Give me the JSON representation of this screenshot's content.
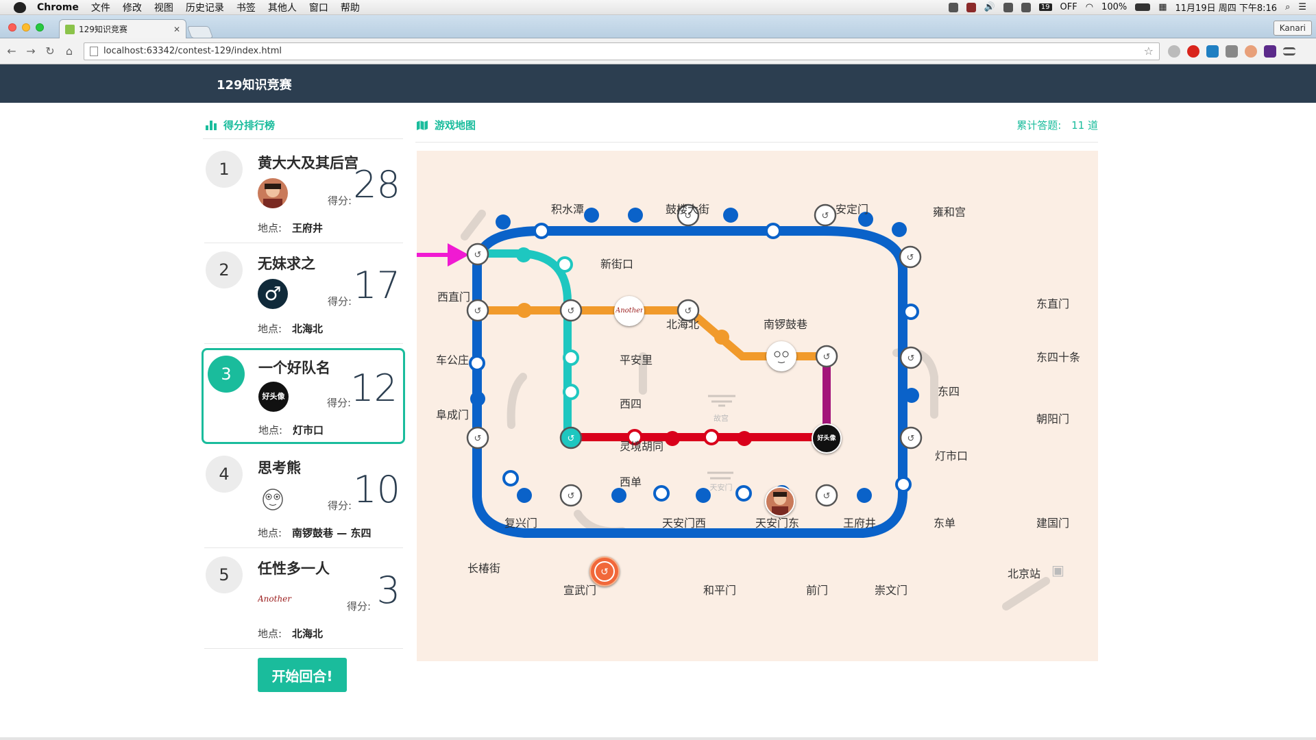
{
  "menubar": {
    "app": "Chrome",
    "items": [
      "文件",
      "修改",
      "视图",
      "历史记录",
      "书签",
      "其他人",
      "窗口",
      "帮助"
    ],
    "status": {
      "badge": "19",
      "off": "OFF",
      "battery": "100%",
      "datetime": "11月19日 周四 下午8:16"
    }
  },
  "browser": {
    "tab_title": "129知识竞赛",
    "url": "localhost:63342/contest-129/index.html",
    "profile": "Kanari"
  },
  "app": {
    "title": "129知识竞赛"
  },
  "ranking": {
    "heading": "得分排行榜",
    "score_label": "得分:",
    "location_label": "地点:",
    "teams": [
      {
        "rank": "1",
        "name": "黄大大及其后宫",
        "score": "28",
        "location": "王府井"
      },
      {
        "rank": "2",
        "name": "无妹求之",
        "score": "17",
        "location": "北海北"
      },
      {
        "rank": "3",
        "name": "一个好队名",
        "score": "12",
        "location": "灯市口"
      },
      {
        "rank": "4",
        "name": "思考熊",
        "score": "10",
        "location": "南锣鼓巷 — 东四"
      },
      {
        "rank": "5",
        "name": "任性多一人",
        "score": "3",
        "location": "北海北"
      }
    ],
    "avatars": {
      "team5_text": "Another",
      "team3_text": "好头像",
      "team2_symbol": "♂"
    }
  },
  "start_button": "开始回合!",
  "map": {
    "heading": "游戏地图",
    "count_label": "累计答题:",
    "count_value": "11 道",
    "stations": [
      "积水潭",
      "鼓楼大街",
      "安定门",
      "雍和宫",
      "西直门",
      "新街口",
      "东直门",
      "北海北",
      "南锣鼓巷",
      "车公庄",
      "平安里",
      "东四十条",
      "东四",
      "西四",
      "阜成门",
      "朝阳门",
      "灵境胡同",
      "灯市口",
      "西单",
      "复兴门",
      "天安门西",
      "天安门东",
      "王府井",
      "东单",
      "建国门",
      "长椿街",
      "宣武门",
      "和平门",
      "前门",
      "崇文门",
      "北京站"
    ],
    "landmarks": [
      "故宫",
      "天安门"
    ],
    "colors": {
      "loop": "#0a62c9",
      "teal": "#1ec7c0",
      "orange": "#f19a2b",
      "red": "#d9001b",
      "purple": "#a3157a",
      "arrow": "#f01ad2"
    }
  }
}
